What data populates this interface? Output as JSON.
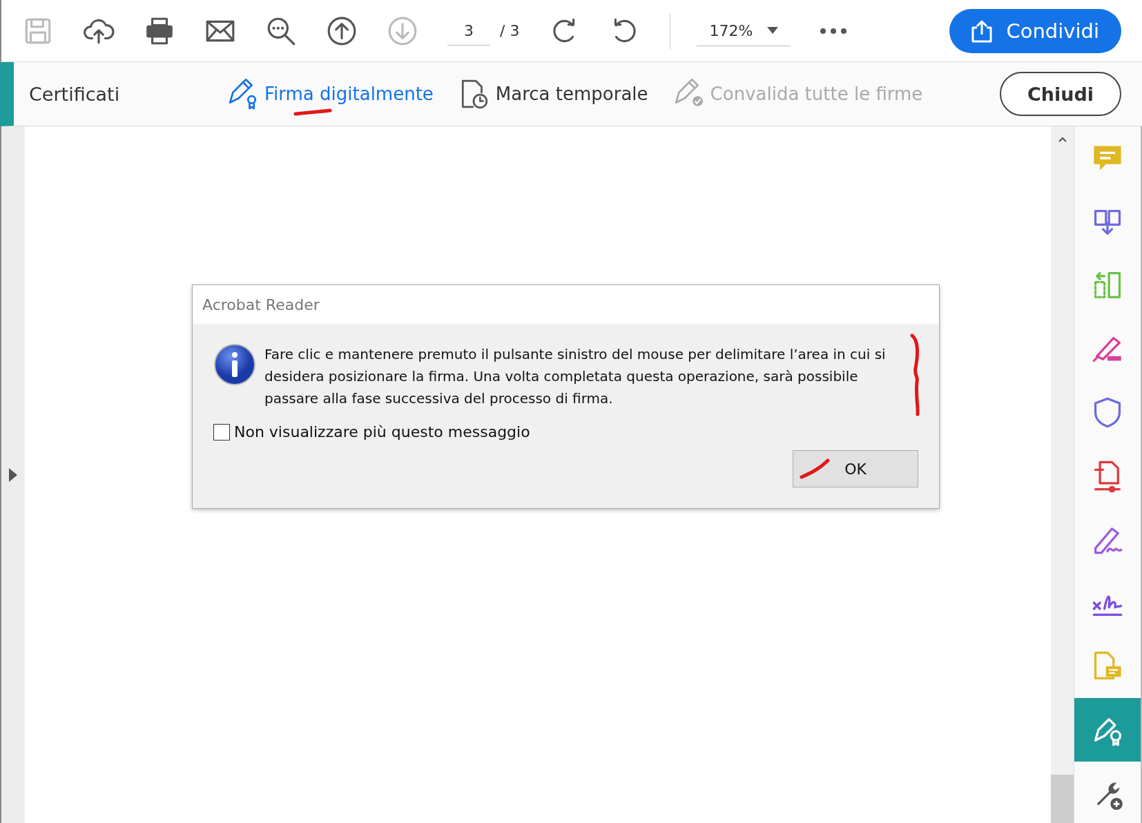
{
  "toolbar": {
    "tools": [
      {
        "kind": "save",
        "disabled": true
      },
      {
        "kind": "upload",
        "disabled": false
      },
      {
        "kind": "print",
        "disabled": false
      },
      {
        "kind": "mail",
        "disabled": false
      },
      {
        "kind": "zoom",
        "disabled": false
      },
      {
        "kind": "prev",
        "disabled": false
      },
      {
        "kind": "next",
        "disabled": true
      }
    ],
    "page": {
      "value": "3",
      "total": "/ 3"
    },
    "rotations": [
      {
        "kind": "rotate-cw"
      },
      {
        "kind": "rotate-ccw"
      }
    ],
    "zoom": {
      "value": "172%"
    },
    "share_button": "Condividi"
  },
  "certificates_bar": {
    "title": "Certificati",
    "tools": [
      {
        "kind": "sign",
        "label": "Firma digitalmente",
        "selected": true,
        "disabled": false
      },
      {
        "kind": "timestamp",
        "label": "Marca temporale",
        "selected": false,
        "disabled": false
      },
      {
        "kind": "validate",
        "label": "Convalida tutte le firme",
        "selected": false,
        "disabled": true
      }
    ],
    "close_button": "Chiudi"
  },
  "dialog": {
    "title": "Acrobat Reader",
    "message": "Fare clic e mantenere premuto il pulsante sinistro del mouse per delimitare l’area in cui si desidera posizionare la firma. Una volta completata questa operazione, sarà possibile passare alla fase successiva del processo di firma.",
    "checkbox": {
      "label": "Non visualizzare più questo messaggio",
      "checked": false
    },
    "ok_button": "OK"
  },
  "right_sidebar": {
    "tools": [
      {
        "kind": "comment",
        "selected": false
      },
      {
        "kind": "combine",
        "selected": false
      },
      {
        "kind": "organize",
        "selected": false
      },
      {
        "kind": "redact",
        "selected": false
      },
      {
        "kind": "protect",
        "selected": false
      },
      {
        "kind": "export",
        "selected": false
      },
      {
        "kind": "fill-sign",
        "selected": false
      },
      {
        "kind": "signature",
        "selected": false
      },
      {
        "kind": "review",
        "selected": false
      },
      {
        "kind": "certificate",
        "selected": true
      },
      {
        "kind": "more-tools",
        "selected": false
      }
    ]
  }
}
